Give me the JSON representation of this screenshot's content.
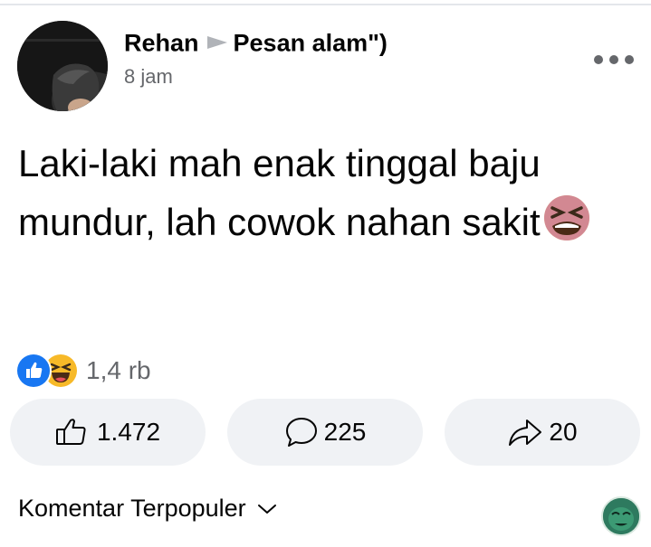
{
  "post": {
    "author_name": "Rehan",
    "group_name": "Pesan alam\")",
    "time": "8 jam",
    "text": "Laki-laki mah enak tinggal baju mundur, lah cowok nahan sakit",
    "text_emoji": "tired-face-emoji"
  },
  "reactions": {
    "icons": [
      "like-icon",
      "haha-icon"
    ],
    "count": "1,4 rb"
  },
  "actions": {
    "like_count": "1.472",
    "comment_count": "225",
    "share_count": "20"
  },
  "comments": {
    "sort_label": "Komentar Terpopuler"
  },
  "colors": {
    "like_blue": "#1877f2",
    "secondary_text": "#65676b",
    "pill_bg": "#f0f2f5"
  }
}
